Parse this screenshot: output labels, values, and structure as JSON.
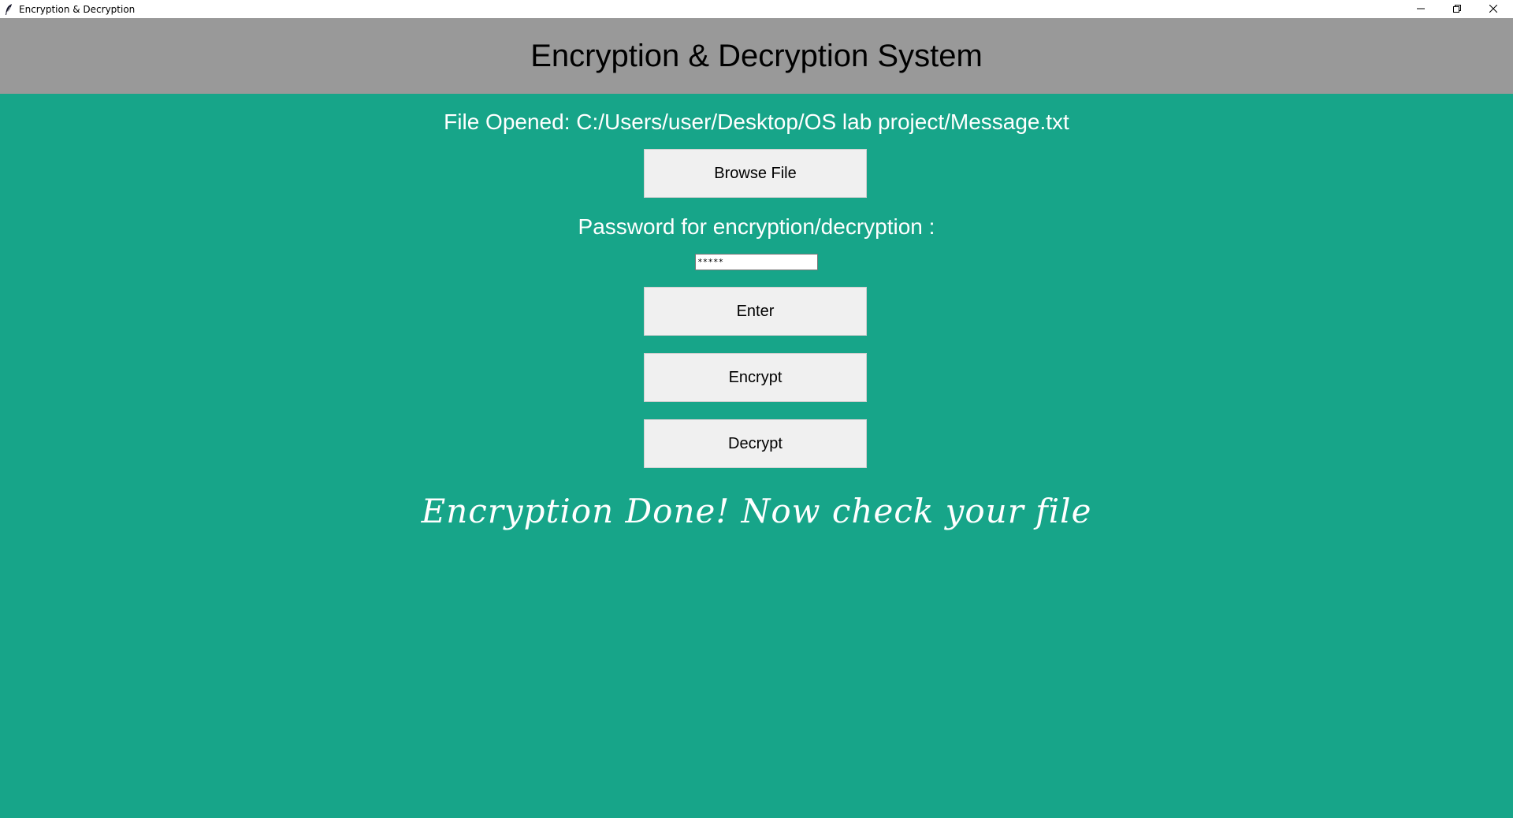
{
  "window": {
    "title": "Encryption & Decryption",
    "background_color": "#17a589",
    "header_color": "#999999",
    "icons": {
      "app": "feather-icon",
      "minimize": "minimize-icon",
      "restore": "restore-icon",
      "close": "close-icon"
    }
  },
  "header": {
    "title": "Encryption & Decryption System"
  },
  "file": {
    "opened_text": "File Opened: C:/Users/user/Desktop/OS lab project/Message.txt"
  },
  "buttons": {
    "browse": "Browse File",
    "enter": "Enter",
    "encrypt": "Encrypt",
    "decrypt": "Decrypt"
  },
  "password": {
    "label": "Password for encryption/decryption :",
    "value": "*****"
  },
  "status": {
    "message": "Encryption Done! Now check your file"
  }
}
